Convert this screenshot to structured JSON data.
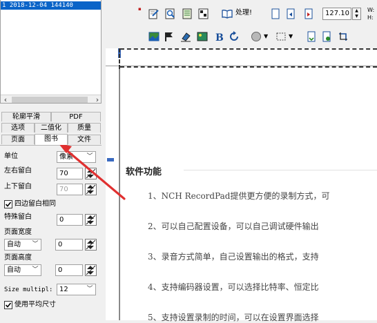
{
  "file_list": {
    "selected_row": "1 2018-12-04 144140"
  },
  "tabs": {
    "row1": [
      "轮廓平滑",
      "PDF"
    ],
    "row2": [
      "选项",
      "二值化",
      "质量"
    ],
    "row3": [
      "页面",
      "图书",
      "文件"
    ]
  },
  "settings": {
    "unit_label": "单位",
    "unit_value": "像素",
    "left_right_margin_label": "左右留白",
    "left_right_margin_value": "70",
    "top_bottom_margin_label": "上下留白",
    "top_bottom_margin_value": "70",
    "same_margins_label": "四边留白相同",
    "special_margin_label": "特殊留白",
    "special_margin_value": "0",
    "page_width_label": "页面宽度",
    "page_width_mode": "自动",
    "page_width_value": "0",
    "page_height_label": "页面高度",
    "page_height_mode": "自动",
    "page_height_value": "0",
    "size_multiplier_label": "Size multipl:",
    "size_multiplier_value": "12",
    "use_average_size_label": "使用平均尺寸"
  },
  "toolbar": {
    "process_label": "处理!",
    "zoom_value": "127.10",
    "wh_line1": "W:",
    "wh_line2": "H:"
  },
  "document": {
    "section_title": "软件功能",
    "features": [
      "1、NCH RecordPad提供更方便的录制方式，可",
      "2、可以自己配置设备，可以自己调试硬件输出",
      "3、录音方式简单，自己设置输出的格式，支持",
      "4、支持编码器设置，可以选择比特率、恒定比",
      "5、支持设置录制的时间，可以在设置界面选择"
    ]
  },
  "colors": {
    "selection": "#0a64c8",
    "arrow": "#e03030",
    "canvas_bg": "#7a7a7a"
  }
}
